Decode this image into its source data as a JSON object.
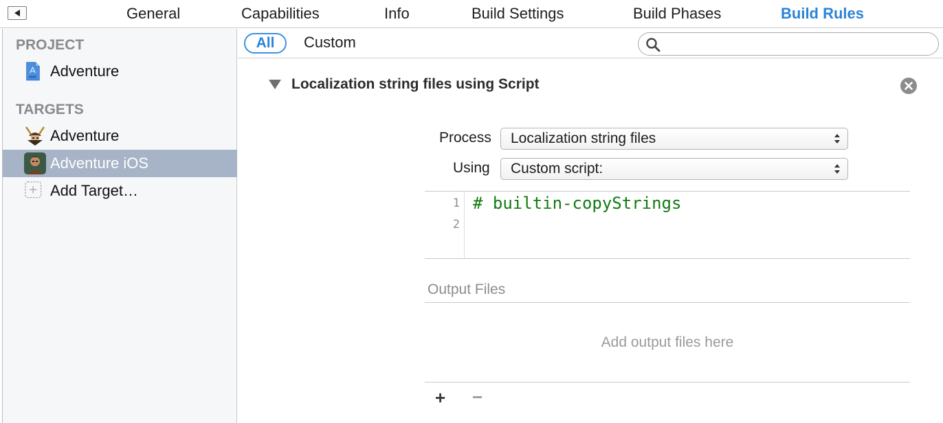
{
  "tabs": [
    {
      "label": "General"
    },
    {
      "label": "Capabilities"
    },
    {
      "label": "Info"
    },
    {
      "label": "Build Settings"
    },
    {
      "label": "Build Phases"
    },
    {
      "label": "Build Rules",
      "active": true
    }
  ],
  "sidebar": {
    "project_header": "PROJECT",
    "project_item": "Adventure",
    "targets_header": "TARGETS",
    "targets": [
      {
        "label": "Adventure",
        "icon": "samurai-helmet-icon"
      },
      {
        "label": "Adventure iOS",
        "icon": "character-portrait-icon",
        "selected": true
      }
    ],
    "add_target": "Add Target…"
  },
  "filter": {
    "all_label": "All",
    "custom_label": "Custom",
    "search_value": ""
  },
  "rule": {
    "title": "Localization string files using Script",
    "process_label": "Process",
    "process_value": "Localization string files",
    "using_label": "Using",
    "using_value": "Custom script:",
    "script_lines": [
      {
        "num": "1",
        "code": "# builtin-copyStrings"
      },
      {
        "num": "2",
        "code": ""
      }
    ],
    "output_files_title": "Output Files",
    "output_placeholder": "Add output files here",
    "add_label": "+",
    "remove_label": "−"
  },
  "colors": {
    "accent": "#2a84d6",
    "selection": "#a7b3c6",
    "script_comment": "#127a12"
  }
}
